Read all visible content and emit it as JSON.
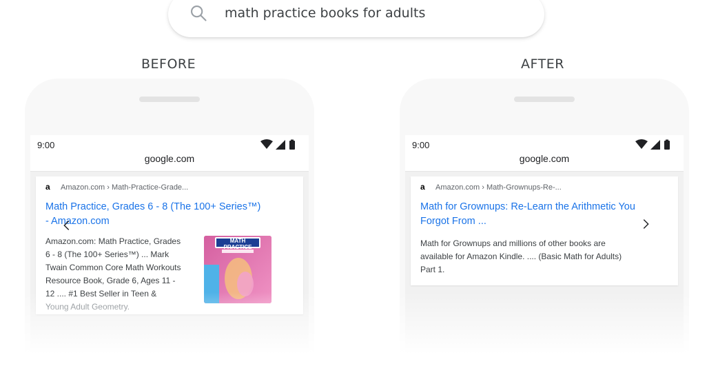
{
  "search": {
    "query": "math practice books for adults"
  },
  "before": {
    "label": "BEFORE",
    "status_time": "9:00",
    "url": "google.com",
    "result": {
      "source": "Amazon.com › Math-Practice-Grade...",
      "title_line1": "Math Practice, Grades 6 - 8 (The 100+ Series™)",
      "title_line2": "- Amazon.com",
      "snippet_lines": [
        "Amazon.com: Math Practice, Grades",
        "6 - 8 (The 100+ Series™) ... Mark",
        "Twain Common Core Math Workouts",
        "Resource Book, Grade 6, Ages 11 -",
        "12 .... #1 Best Seller in Teen &",
        "Young Adult Geometry."
      ],
      "thumbnail_title": "MATH PRACTICE"
    }
  },
  "after": {
    "label": "AFTER",
    "status_time": "9:00",
    "url": "google.com",
    "result": {
      "source": "Amazon.com › Math-Grownups-Re-...",
      "title_line1": "Math for Grownups: Re-Learn the Arithmetic You",
      "title_line2": "Forgot From ...",
      "snippet_lines": [
        "Math for Grownups and millions of other books are",
        "available for Amazon Kindle. .... (Basic Math for Adults)",
        "Part 1."
      ]
    }
  },
  "icons": {
    "search": "search-icon",
    "prev": "chevron-left-icon",
    "next": "chevron-right-icon",
    "wifi": "wifi-icon",
    "signal": "signal-icon",
    "battery": "battery-icon"
  },
  "colors": {
    "link": "#1a73e8",
    "text": "#3c4043",
    "muted": "#5f6368"
  }
}
